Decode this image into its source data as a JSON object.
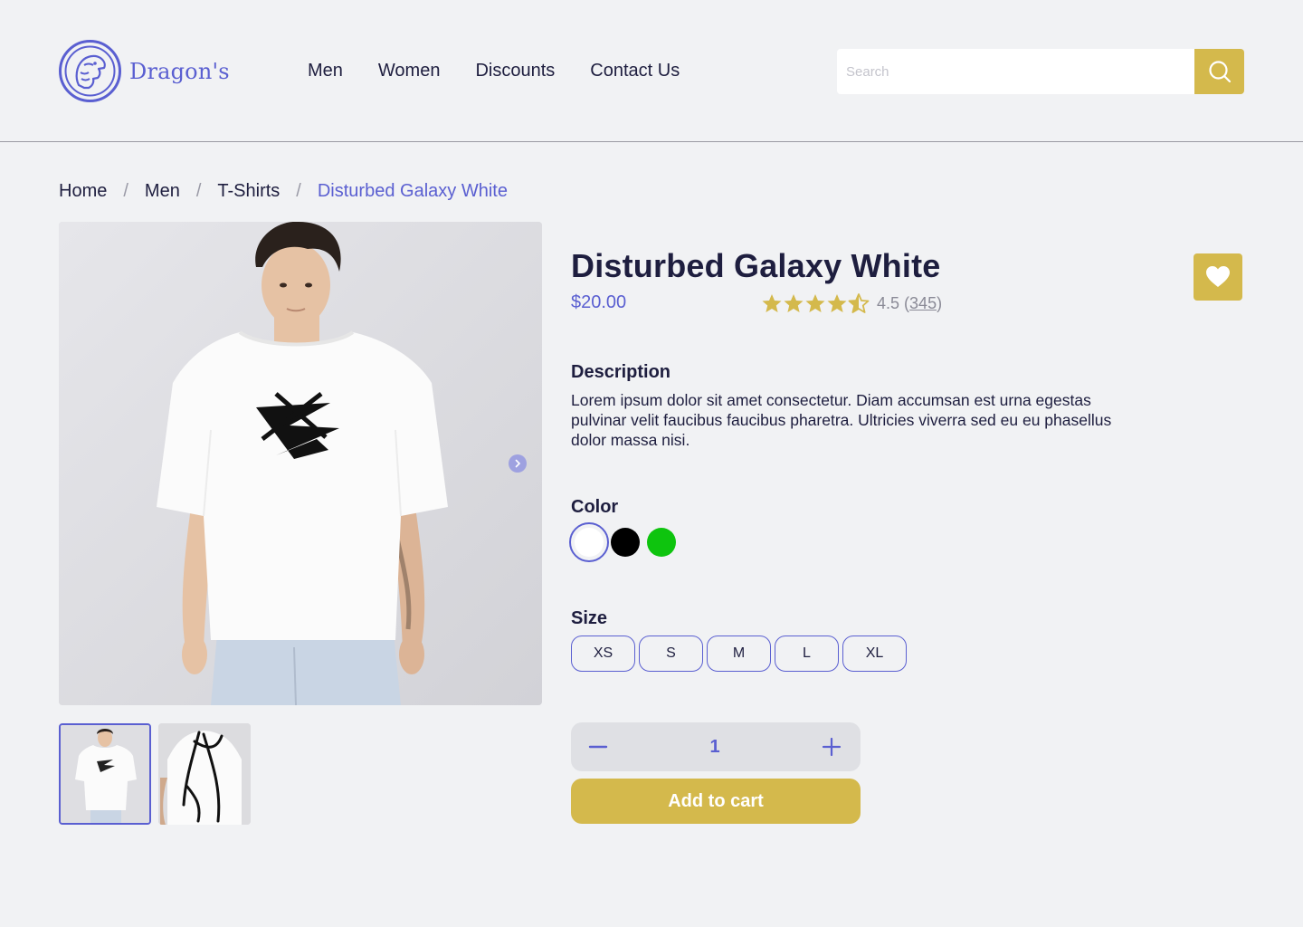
{
  "brand": {
    "name": "Dragon's",
    "accent": "#5a5fd1",
    "gold": "#d4b94c"
  },
  "nav": {
    "items": [
      "Men",
      "Women",
      "Discounts",
      "Contact Us"
    ]
  },
  "search": {
    "placeholder": "Search",
    "value": "",
    "icon": "search-icon"
  },
  "breadcrumb": {
    "items": [
      "Home",
      "Men",
      "T-Shirts",
      "Disturbed Galaxy White"
    ],
    "separator": "/"
  },
  "gallery": {
    "next_icon": "chevron-right-icon",
    "thumbnails": 2,
    "active_thumbnail": 0
  },
  "product": {
    "title": "Disturbed Galaxy White",
    "price": "$20.00",
    "rating": {
      "value": "4.5",
      "open": "(",
      "count": "345",
      "close": ")",
      "stars": 4.5
    },
    "favorite_icon": "heart-icon",
    "description_title": "Description",
    "description": "Lorem ipsum dolor sit amet consectetur. Diam accumsan est urna egestas pulvinar velit faucibus faucibus pharetra. Ultricies viverra sed eu eu phasellus dolor massa nisi.",
    "color_title": "Color",
    "colors": [
      {
        "name": "white",
        "hex": "#ffffff",
        "selected": true
      },
      {
        "name": "black",
        "hex": "#000000",
        "selected": false
      },
      {
        "name": "green",
        "hex": "#0ec40e",
        "selected": false
      }
    ],
    "size_title": "Size",
    "sizes": [
      "XS",
      "S",
      "M",
      "L",
      "XL"
    ],
    "quantity": "1",
    "add_to_cart": "Add to cart"
  }
}
